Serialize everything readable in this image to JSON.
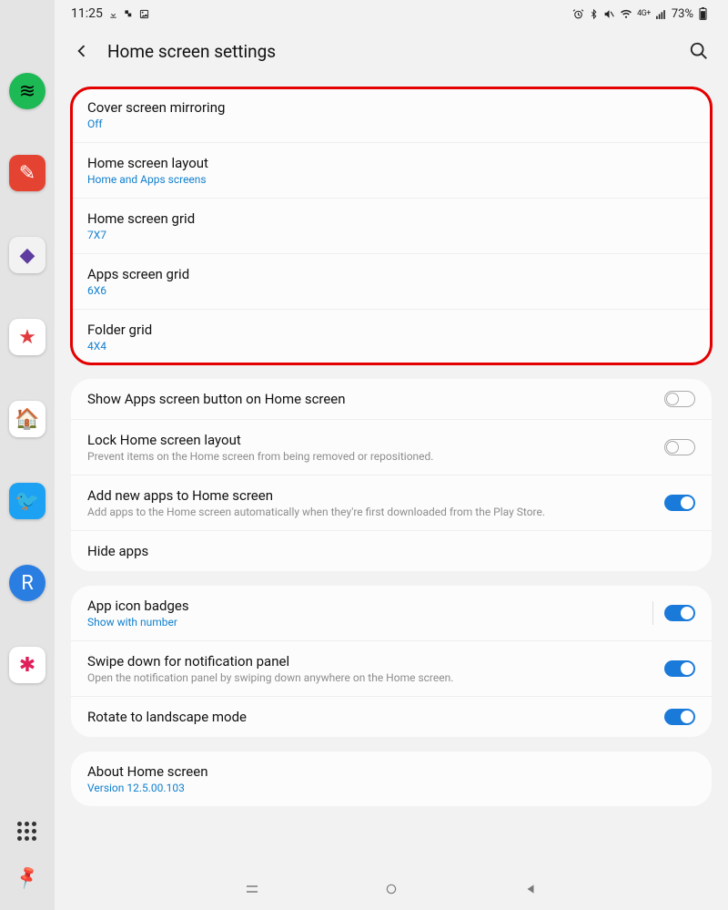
{
  "status": {
    "time": "11:25",
    "battery": "73%"
  },
  "header": {
    "title": "Home screen settings"
  },
  "groups": [
    {
      "highlighted": true,
      "rows": [
        {
          "title": "Cover screen mirroring",
          "sub": "Off"
        },
        {
          "title": "Home screen layout",
          "sub": "Home and Apps screens"
        },
        {
          "title": "Home screen grid",
          "sub": "7X7"
        },
        {
          "title": "Apps screen grid",
          "sub": "6X6"
        },
        {
          "title": "Folder grid",
          "sub": "4X4"
        }
      ]
    },
    {
      "rows": [
        {
          "title": "Show Apps screen button on Home screen",
          "toggle": "off"
        },
        {
          "title": "Lock Home screen layout",
          "desc": "Prevent items on the Home screen from being removed or repositioned.",
          "toggle": "off"
        },
        {
          "title": "Add new apps to Home screen",
          "desc": "Add apps to the Home screen automatically when they're first downloaded from the Play Store.",
          "toggle": "on"
        },
        {
          "title": "Hide apps"
        }
      ]
    },
    {
      "rows": [
        {
          "title": "App icon badges",
          "sub": "Show with number",
          "toggle": "on",
          "sep": true
        },
        {
          "title": "Swipe down for notification panel",
          "desc": "Open the notification panel by swiping down anywhere on the Home screen.",
          "toggle": "on"
        },
        {
          "title": "Rotate to landscape mode",
          "toggle": "on"
        }
      ]
    },
    {
      "rows": [
        {
          "title": "About Home screen",
          "sub": "Version 12.5.00.103"
        }
      ]
    }
  ],
  "edge_apps": [
    {
      "name": "spotify",
      "bg": "#1DB954",
      "circle": true,
      "glyph": "≋",
      "glyphColor": "#000"
    },
    {
      "name": "todoist",
      "bg": "#E44332",
      "glyph": "✎",
      "glyphColor": "#fff"
    },
    {
      "name": "obsidian",
      "bg": "#f2f2f2",
      "glyph": "◆",
      "glyphColor": "#5e3ca0"
    },
    {
      "name": "espn",
      "bg": "#ffffff",
      "glyph": "★",
      "glyphColor": "#e03a3e"
    },
    {
      "name": "home",
      "bg": "#ffffff",
      "glyph": "🏠",
      "glyphColor": ""
    },
    {
      "name": "twitter",
      "bg": "#1DA1F2",
      "glyph": "🐦",
      "glyphColor": "#fff"
    },
    {
      "name": "r-app",
      "bg": "#2a7de1",
      "circle": true,
      "glyph": "R",
      "glyphColor": "#fff"
    },
    {
      "name": "slack",
      "bg": "#ffffff",
      "glyph": "✱",
      "glyphColor": "#e01e5a"
    }
  ]
}
